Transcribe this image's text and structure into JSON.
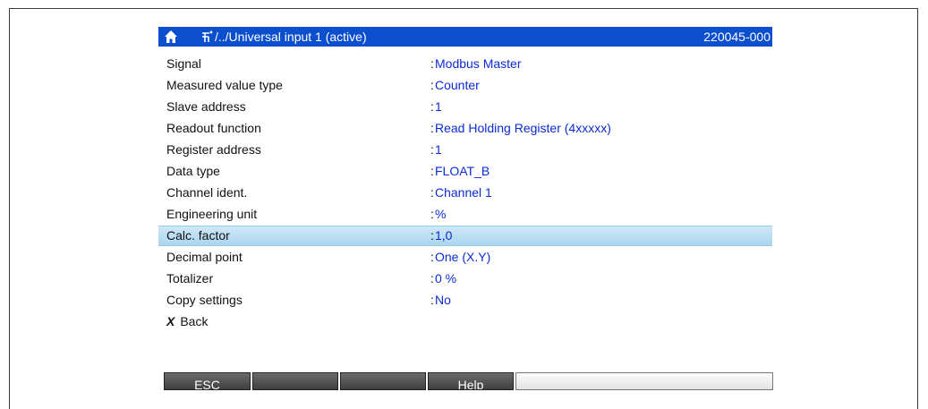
{
  "header": {
    "path": "/../Universal input 1 (active)",
    "code": "220045-000"
  },
  "rows": [
    {
      "label": "Signal",
      "value": "Modbus Master"
    },
    {
      "label": "Measured value type",
      "value": "Counter"
    },
    {
      "label": "Slave address",
      "value": "1"
    },
    {
      "label": "Readout function",
      "value": "Read Holding Register (4xxxxx)"
    },
    {
      "label": "Register address",
      "value": "1"
    },
    {
      "label": "Data type",
      "value": "FLOAT_B"
    },
    {
      "label": "Channel ident.",
      "value": "Channel 1"
    },
    {
      "label": "Engineering unit",
      "value": "%"
    },
    {
      "label": "Calc. factor",
      "value": "1,0"
    },
    {
      "label": "Decimal point",
      "value": "One (X.Y)"
    },
    {
      "label": "Totalizer",
      "value": "0 %"
    },
    {
      "label": "Copy settings",
      "value": "No"
    }
  ],
  "selected_row": "Calc. factor",
  "back": {
    "icon": "x-icon",
    "label": "Back"
  },
  "softkeys": [
    "ESC",
    "",
    "",
    "Help",
    ""
  ],
  "colors": {
    "titlebar": "#0b4fcf",
    "value_text": "#0b2bd4",
    "highlight": "#aad6f0"
  }
}
